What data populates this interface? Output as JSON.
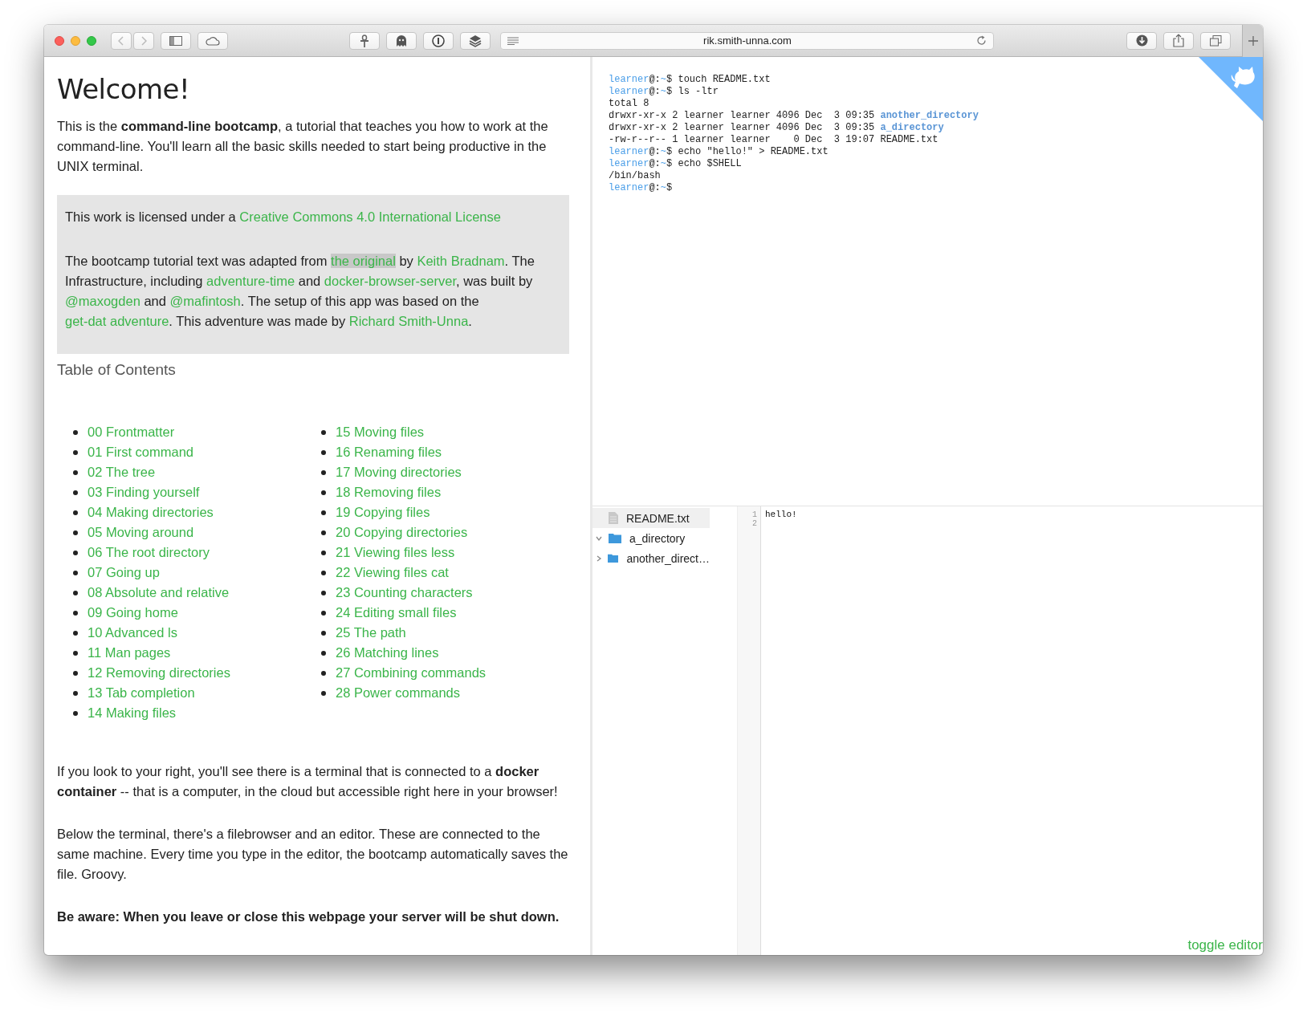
{
  "browser": {
    "url": "rik.smith-unna.com"
  },
  "tutorial": {
    "title": "Welcome!",
    "intro": "This is the **command-line bootcamp**, a tutorial that teaches you how to work at the command-line. You'll learn all the basic skills needed to start being productive in the UNIX terminal.",
    "license_box": {
      "paragraphs": [
        [
          {
            "text": "This work is licensed under a ",
            "link": false
          },
          {
            "text": "Creative Commons 4.0 International License",
            "link": true,
            "highlighted": false
          }
        ],
        [
          {
            "text": "The bootcamp tutorial text was adapted from ",
            "link": false
          },
          {
            "text": "the original",
            "link": true,
            "highlighted": true
          },
          {
            "text": " by ",
            "link": false
          },
          {
            "text": "Keith Bradnam",
            "link": true,
            "highlighted": false
          },
          {
            "text": ". The Infrastructure, including ",
            "link": false
          },
          {
            "text": "adventure-time",
            "link": true,
            "highlighted": false
          },
          {
            "text": " and ",
            "link": false
          },
          {
            "text": "docker-browser-server",
            "link": true,
            "highlighted": false
          },
          {
            "text": ", was built by ",
            "link": false
          },
          {
            "text": "@maxogden",
            "link": true,
            "highlighted": false
          },
          {
            "text": " and ",
            "link": false
          },
          {
            "text": "@mafintosh",
            "link": true,
            "highlighted": false
          },
          {
            "text": ". The setup of this app was based on the ",
            "link": false
          },
          {
            "text": "get-dat adventure",
            "link": true,
            "highlighted": false
          },
          {
            "text": ". This adventure was made by ",
            "link": false
          },
          {
            "text": "Richard Smith-Unna",
            "link": true,
            "highlighted": false
          },
          {
            "text": ".",
            "link": false
          }
        ]
      ]
    },
    "toc": {
      "title": "Table of Contents",
      "columns": [
        [
          "00 Frontmatter",
          "01 First command",
          "02 The tree",
          "03 Finding yourself",
          "04 Making directories",
          "05 Moving around",
          "06 The root directory",
          "07 Going up",
          "08 Absolute and relative",
          "09 Going home",
          "10 Advanced ls",
          "11 Man pages",
          "12 Removing directories",
          "13 Tab completion",
          "14 Making files"
        ],
        [
          "15 Moving files",
          "16 Renaming files",
          "17 Moving directories",
          "18 Removing files",
          "19 Copying files",
          "20 Copying directories",
          "21 Viewing files less",
          "22 Viewing files cat",
          "23 Counting characters",
          "24 Editing small files",
          "25 The path",
          "26 Matching lines",
          "27 Combining commands",
          "28 Power commands"
        ]
      ]
    },
    "paragraphs": [
      "If you look to your right, you'll see there is a terminal that is connected to a **docker container** -- that is a computer, in the cloud but accessible right here in your browser!",
      "Below the terminal, there's a filebrowser and an editor. These are connected to the same machine. Every time you type in the editor, the bootcamp automatically saves the file. Groovy."
    ],
    "warning": "Be aware: When you leave or close this webpage your server will be shut down."
  },
  "terminal": {
    "lines": [
      [
        {
          "text": "learner",
          "kind": "prompt"
        },
        {
          "text": "@:",
          "kind": "plain"
        },
        {
          "text": "~",
          "kind": "prompt"
        },
        {
          "text": "$ touch README.txt",
          "kind": "plain"
        }
      ],
      [
        {
          "text": "learner",
          "kind": "prompt"
        },
        {
          "text": "@:",
          "kind": "plain"
        },
        {
          "text": "~",
          "kind": "prompt"
        },
        {
          "text": "$ ls -ltr",
          "kind": "plain"
        }
      ],
      [
        {
          "text": "total 8",
          "kind": "plain"
        }
      ],
      [
        {
          "text": "drwxr-xr-x 2 learner learner 4096 Dec  3 09:35 ",
          "kind": "plain"
        },
        {
          "text": "another_directory",
          "kind": "dir"
        }
      ],
      [
        {
          "text": "drwxr-xr-x 2 learner learner 4096 Dec  3 09:35 ",
          "kind": "plain"
        },
        {
          "text": "a_directory",
          "kind": "dir"
        }
      ],
      [
        {
          "text": "-rw-r--r-- 1 learner learner    0 Dec  3 19:07 README.txt",
          "kind": "plain"
        }
      ],
      [
        {
          "text": "learner",
          "kind": "prompt"
        },
        {
          "text": "@:",
          "kind": "plain"
        },
        {
          "text": "~",
          "kind": "prompt"
        },
        {
          "text": "$ echo \"hello!\" > README.txt",
          "kind": "plain"
        }
      ],
      [
        {
          "text": "learner",
          "kind": "prompt"
        },
        {
          "text": "@:",
          "kind": "plain"
        },
        {
          "text": "~",
          "kind": "prompt"
        },
        {
          "text": "$ echo $SHELL",
          "kind": "plain"
        }
      ],
      [
        {
          "text": "/bin/bash",
          "kind": "plain"
        }
      ],
      [
        {
          "text": "learner",
          "kind": "prompt"
        },
        {
          "text": "@:",
          "kind": "plain"
        },
        {
          "text": "~",
          "kind": "prompt"
        },
        {
          "text": "$",
          "kind": "plain"
        }
      ]
    ]
  },
  "file_tree": {
    "items": [
      {
        "name": "README.txt",
        "kind": "file",
        "selected": true
      },
      {
        "name": "a_directory",
        "kind": "folder",
        "expanded": true,
        "selected": false
      },
      {
        "name": "another_direct…",
        "kind": "folder",
        "expanded": false,
        "selected": false
      }
    ]
  },
  "editor": {
    "line_numbers": [
      "1",
      "2"
    ],
    "lines": [
      "hello!"
    ]
  },
  "toggle_editor": "toggle editor"
}
